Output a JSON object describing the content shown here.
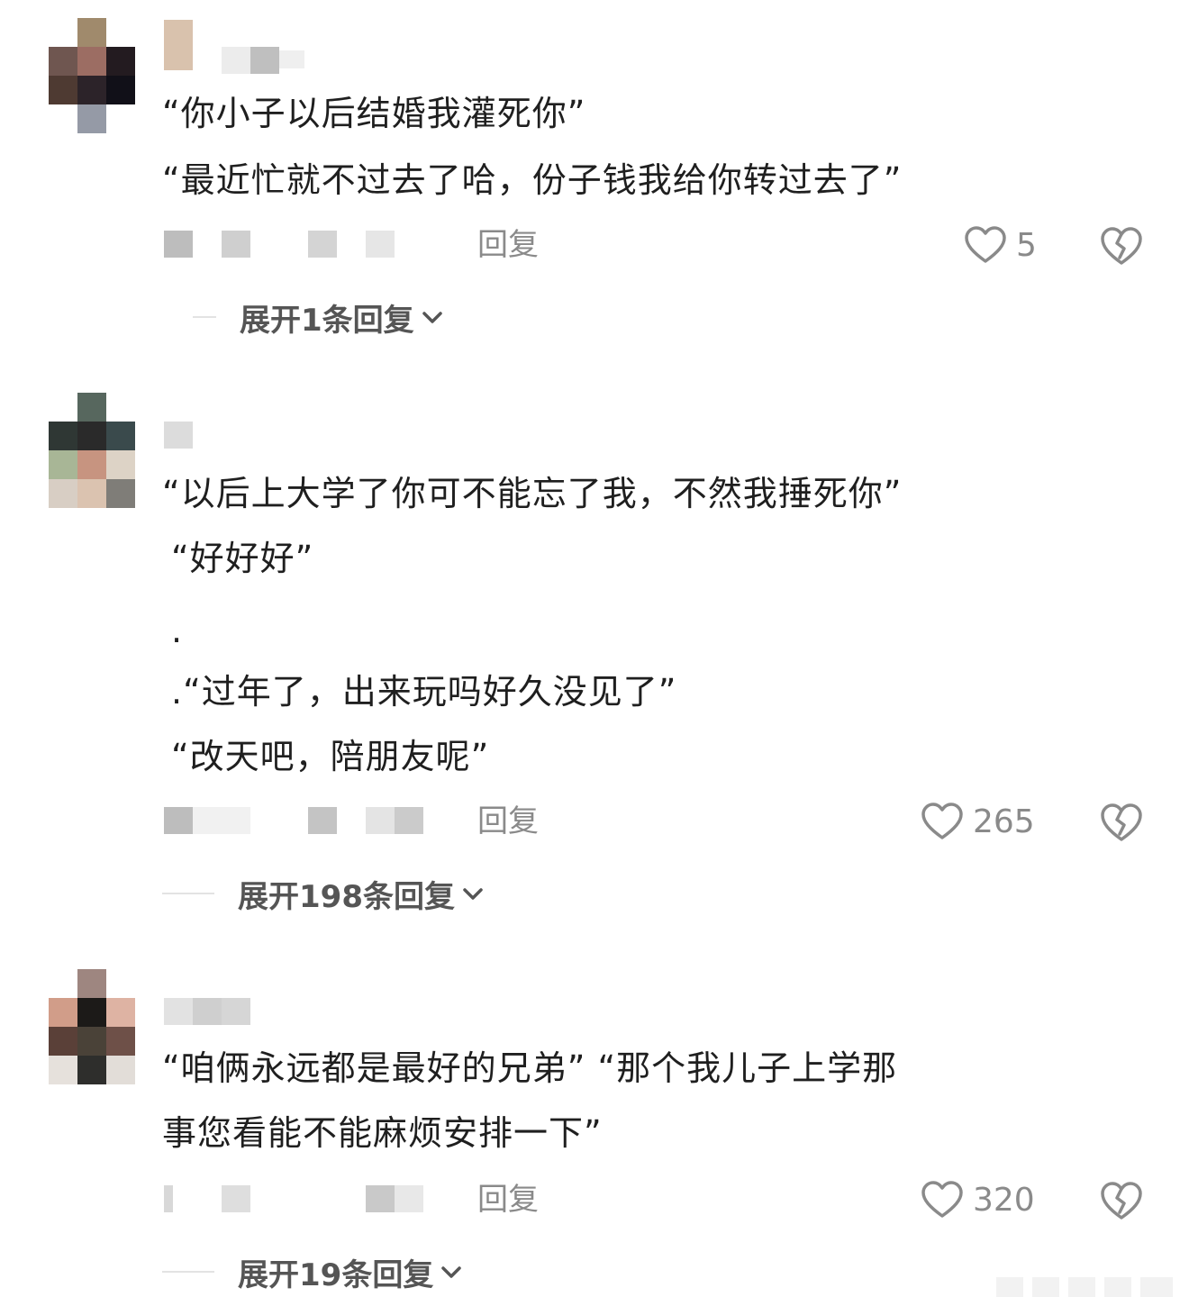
{
  "comments": [
    {
      "lines": [
        "“你小子以后结婚我灌死你”",
        "“最近忙就不过去了哈，份子钱我给你转过去了”"
      ],
      "reply_label": "回复",
      "like_count": "5",
      "expand_label": "展开1条回复",
      "avatar_colors": [
        "#ffffff",
        "#a08a6c",
        "#ffffff",
        "#6f5650",
        "#9c6d63",
        "#231b20",
        "#4e3a32",
        "#2c2329",
        "#111018",
        "#ffffff",
        "#959aa6",
        "#ffffff"
      ]
    },
    {
      "lines": [
        "“以后上大学了你可不能忘了我，不然我捶死你”",
        "“好好好”",
        ".",
        ".“过年了，出来玩吗好久没见了”",
        "“改天吧，陪朋友呢”"
      ],
      "reply_label": "回复",
      "like_count": "265",
      "expand_label": "展开198条回复",
      "avatar_colors": [
        "#ffffff",
        "#57675e",
        "#ffffff",
        "#2f3734",
        "#2a2a2a",
        "#3a4a4c",
        "#a8b696",
        "#c79480",
        "#ddd3c6",
        "#d8cec4",
        "#dbc3b0",
        "#7f7d78"
      ]
    },
    {
      "lines": [
        "“咱俩永远都是最好的兄弟”            “那个我儿子上学那",
        "事您看能不能麻烦安排一下”"
      ],
      "reply_label": "回复",
      "like_count": "320",
      "expand_label": "展开19条回复",
      "avatar_colors": [
        "#ffffff",
        "#9e8680",
        "#ffffff",
        "#d19d89",
        "#1c1a18",
        "#deb3a3",
        "#5a4038",
        "#4a4238",
        "#6e5048",
        "#e6e1dc",
        "#2e2e2c",
        "#e2ddd8"
      ]
    }
  ],
  "icons": {
    "like": "heart-outline-icon",
    "dislike": "broken-heart-icon",
    "expand": "chevron-down-icon"
  },
  "colors": {
    "meta_gray": "#8a8a8a",
    "text": "#1f1f1f",
    "expand_text": "#555555"
  }
}
